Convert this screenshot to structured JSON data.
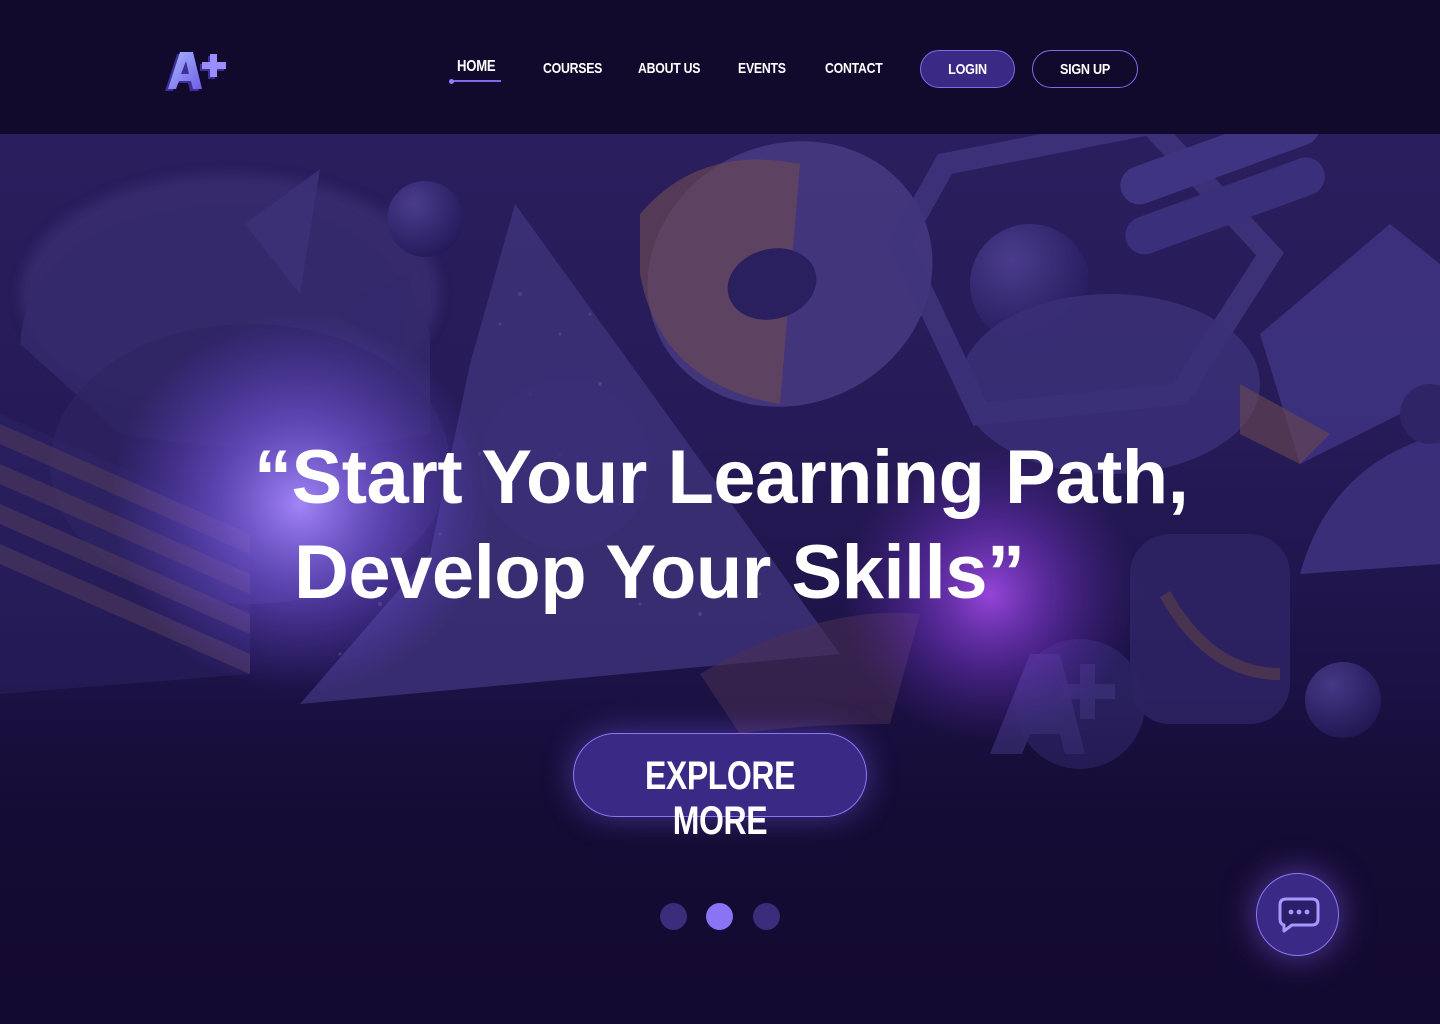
{
  "header": {
    "nav": [
      {
        "label": "HOME",
        "active": true
      },
      {
        "label": "COURSES"
      },
      {
        "label": "ABOUT US"
      },
      {
        "label": "EVENTS"
      },
      {
        "label": "CONTACT"
      }
    ],
    "login_label": "LOGIN",
    "signup_label": "SIGN UP"
  },
  "hero": {
    "headline_line1": "“Start Your Learning Path,",
    "headline_line2": "Develop Your Skills”",
    "cta_label": "EXPLORE MORE",
    "carousel": {
      "total": 3,
      "active_index": 2
    }
  },
  "logo": {
    "icon": "a-plus-logo-icon",
    "text": "A+"
  },
  "chat": {
    "icon": "chat-bubble-icon"
  },
  "colors": {
    "background": "#130a30",
    "header": "#110a2d",
    "accent": "#8b73f6",
    "button_fill": "#3a2a86",
    "button_border": "#7e6be6"
  }
}
